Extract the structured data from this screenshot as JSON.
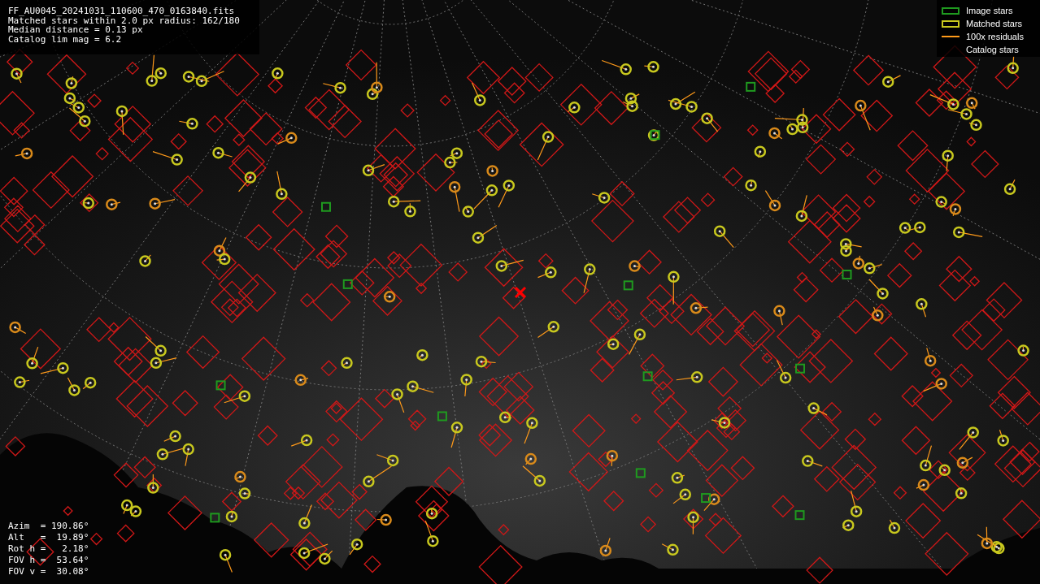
{
  "info_lines": [
    "FF_AU0045_20241031_110600_470_0163840.fits",
    "Matched stars within 2.0 px radius: 162/180",
    "Median distance = 0.13 px",
    "Catalog lim mag = 6.2"
  ],
  "legend": [
    {
      "kind": "image",
      "label": "Image stars"
    },
    {
      "kind": "matched",
      "label": "Matched stars"
    },
    {
      "kind": "residual",
      "label": "100x residuals"
    },
    {
      "kind": "catalog",
      "label": "Catalog stars"
    }
  ],
  "pointing": [
    "Azim  = 190.86°",
    "Alt   =  19.89°",
    "Rot h =   2.18°",
    "FOV h =  53.64°",
    "FOV v =  30.08°"
  ]
}
